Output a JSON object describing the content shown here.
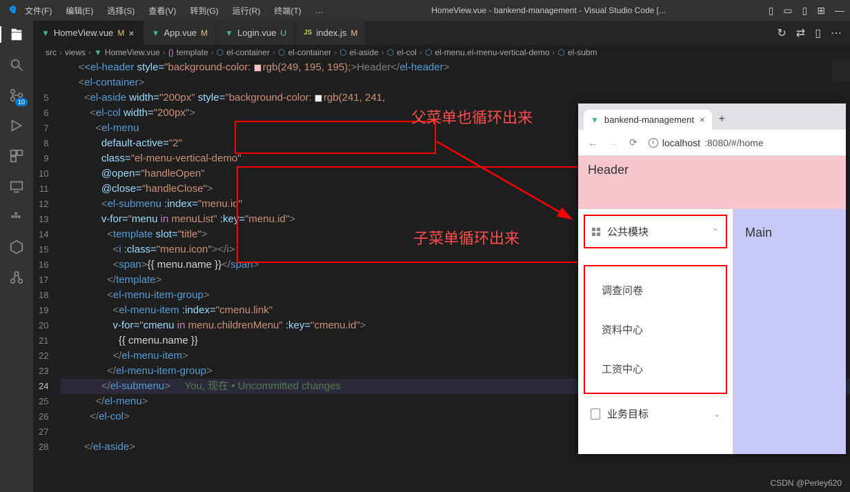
{
  "title": "HomeView.vue - bankend-management - Visual Studio Code [...",
  "menu": [
    "文件(F)",
    "编辑(E)",
    "选择(S)",
    "查看(V)",
    "转到(G)",
    "运行(R)",
    "终端(T)",
    "…"
  ],
  "scm_badge": "10",
  "tabs": [
    {
      "icon": "vue",
      "name": "HomeView.vue",
      "mod": "M",
      "modClass": "m",
      "active": true,
      "close": true
    },
    {
      "icon": "vue",
      "name": "App.vue",
      "mod": "M",
      "modClass": "m"
    },
    {
      "icon": "vue",
      "name": "Login.vue",
      "mod": "U",
      "modClass": "u"
    },
    {
      "icon": "js",
      "name": "index.js",
      "mod": "M",
      "modClass": "m"
    }
  ],
  "breadcrumb": {
    "parts": [
      "src",
      "views",
      "HomeView.vue",
      "template",
      "el-container",
      "el-container",
      "el-aside",
      "el-col",
      "el-menu.el-menu-vertical-demo",
      "el-subm"
    ]
  },
  "line_numbers": [
    "",
    "",
    "5",
    "6",
    "7",
    "8",
    "9",
    "10",
    "11",
    "12",
    "13",
    "14",
    "15",
    "16",
    "17",
    "18",
    "19",
    "20",
    "21",
    "22",
    "23",
    "24",
    "25",
    "26",
    "27",
    "28"
  ],
  "current_line": "24",
  "annotations": {
    "parent_text": "父菜单也循环出来",
    "child_text": "子菜单循环出来"
  },
  "git_blame": "You, 现在 • Uncommitted changes",
  "code": {
    "l0a": "<el-header ",
    "l0b": "style=",
    "l0c": "\"background-color: ",
    "l0d": "rgb(249, 195, 195);",
    "l0e": ">Header</",
    "l0f": "el-header",
    "l0g": ">",
    "l1a": "<el-container>",
    "l2a": "<el-aside ",
    "l2b": "width=",
    "l2c": "\"200px\"",
    "l2d": " style=",
    "l2e": "\"background-color: ",
    "l2f": "rgb(241, 241,",
    "l3a": "<el-col ",
    "l3b": "width=",
    "l3c": "\"200px\"",
    "l3d": ">",
    "l4a": "<el-menu",
    "l5a": "default-active=",
    "l5b": "\"2\"",
    "l6a": "class=",
    "l6b": "\"el-menu-vertical-demo\"",
    "l7a": "@open=",
    "l7b": "\"handleOpen\"",
    "l8a": "@close=",
    "l8b": "\"handleClose\"",
    "l8c": ">",
    "l9a": "<el-submenu ",
    "l9b": ":index=",
    "l9c": "\"menu.id\"",
    "l10a": "v-for=",
    "l10b": "\"",
    "l10c": "menu ",
    "l10d": "in",
    "l10e": " menuList\"",
    "l10f": " :key=",
    "l10g": "\"menu.id\"",
    "l10h": ">",
    "l11a": "<template ",
    "l11b": "slot=",
    "l11c": "\"title\"",
    "l11d": ">",
    "l12a": "<i ",
    "l12b": ":class=",
    "l12c": "\"menu.icon\"",
    "l12d": "></i>",
    "l13a": "<span>",
    "l13b": "{{ menu.name }}",
    "l13c": "</span>",
    "l14a": "</template>",
    "l15a": "<el-menu-item-group>",
    "l16a": "<el-menu-item ",
    "l16b": ":index=",
    "l16c": "\"cmenu.link\"",
    "l17a": "v-for=",
    "l17b": "\"",
    "l17c": "cmenu ",
    "l17d": "in",
    "l17e": " menu.childrenMenu\"",
    "l17f": " :key=",
    "l17g": "\"cmenu.id\"",
    "l17h": ">",
    "l18a": "{{ cmenu.name }}",
    "l19a": "</el-menu-item>",
    "l20a": "</el-menu-item-group>",
    "l21a": "</el-submenu>",
    "l22a": "</el-menu>",
    "l23a": "</el-col>",
    "l25a": "</el-aside>"
  },
  "browser": {
    "tab_title": "bankend-management",
    "url_host": "localhost",
    "url_rest": ":8080/#/home",
    "header": "Header",
    "main": "Main",
    "menu_parent": "公共模块",
    "menu_children": [
      "调查问卷",
      "资料中心",
      "工资中心"
    ],
    "menu_parent2": "业务目标"
  },
  "watermark": "CSDN @Perley620"
}
